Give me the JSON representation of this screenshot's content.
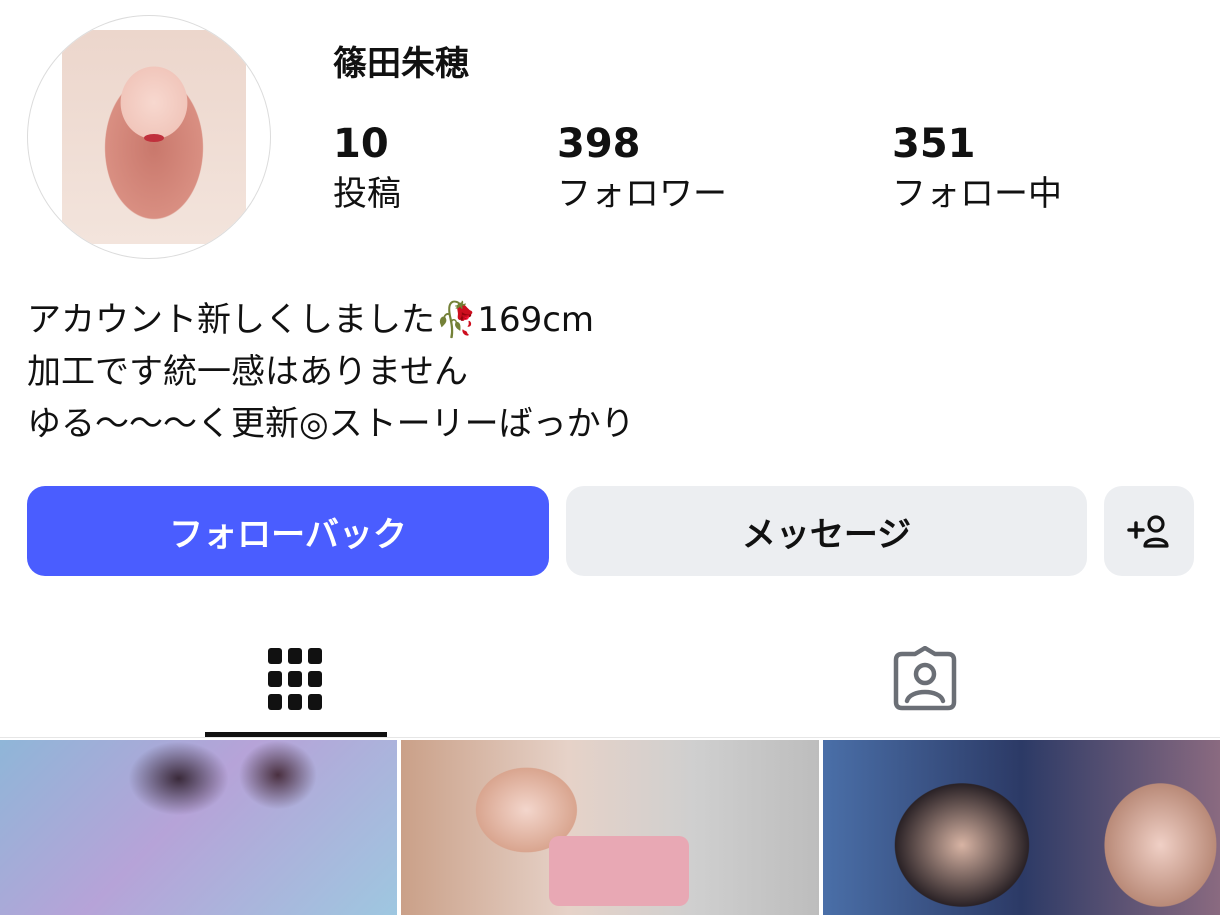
{
  "profile": {
    "username": "篠田朱穂",
    "stats": [
      {
        "value": "10",
        "label": "投稿"
      },
      {
        "value": "398",
        "label": "フォロワー"
      },
      {
        "value": "351",
        "label": "フォロー中"
      }
    ],
    "bio": [
      "アカウント新しくしました🥀169cm",
      "加工です統一感はありません",
      "ゆる〜〜〜く更新◎ストーリーばっかり"
    ]
  },
  "actions": {
    "follow_back": "フォローバック",
    "message": "メッセージ",
    "add_user_icon": "person-plus-icon"
  },
  "tabs": [
    {
      "icon": "grid-icon",
      "active": true
    },
    {
      "icon": "tagged-person-icon",
      "active": false
    }
  ],
  "colors": {
    "primary_button": "#4a5dff",
    "secondary_button": "#eceef1",
    "text": "#111111"
  }
}
